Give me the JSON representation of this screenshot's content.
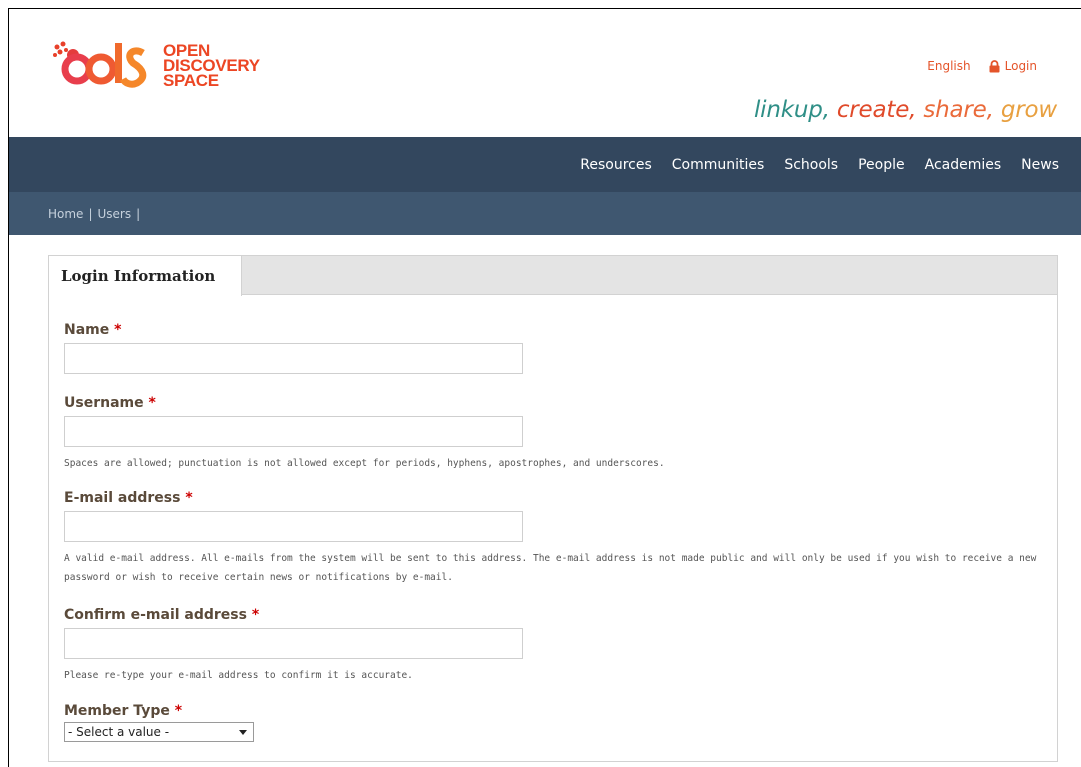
{
  "brand": {
    "logo_lines": [
      "OPEN",
      "DISCOVERY",
      "SPACE"
    ],
    "tagline": [
      {
        "text": "linkup,",
        "color": "#2f8f87"
      },
      {
        "text": " create,",
        "color": "#e04a2a"
      },
      {
        "text": " share,",
        "color": "#ea6a3a"
      },
      {
        "text": " grow",
        "color": "#e8a040"
      }
    ]
  },
  "top_links": {
    "language": "English",
    "login": "Login"
  },
  "nav": {
    "items": [
      "Resources",
      "Communities",
      "Schools",
      "People",
      "Academies",
      "News"
    ]
  },
  "breadcrumb": {
    "home": "Home",
    "users": "Users",
    "separator": "|"
  },
  "form": {
    "tab_label": "Login Information",
    "required_marker": "*",
    "name": {
      "label": "Name",
      "value": "",
      "placeholder": ""
    },
    "username": {
      "label": "Username",
      "value": "",
      "description": "Spaces are allowed; punctuation is not allowed except for periods, hyphens, apostrophes, and underscores."
    },
    "email": {
      "label": "E-mail address",
      "value": "",
      "description": "A valid e-mail address. All e-mails from the system will be sent to this address. The e-mail address is not made public and will only be used if you wish to receive a new password or wish to receive certain news or notifications by e-mail."
    },
    "confirm_email": {
      "label": "Confirm e-mail address",
      "value": "",
      "description": "Please re-type your e-mail address to confirm it is accurate."
    },
    "member_type": {
      "label": "Member Type",
      "selected": "- Select a value -"
    }
  },
  "colors": {
    "nav_bg": "#33475e",
    "crumb_bg": "#3f5770",
    "accent": "#ec4624",
    "required": "#cc0000"
  }
}
